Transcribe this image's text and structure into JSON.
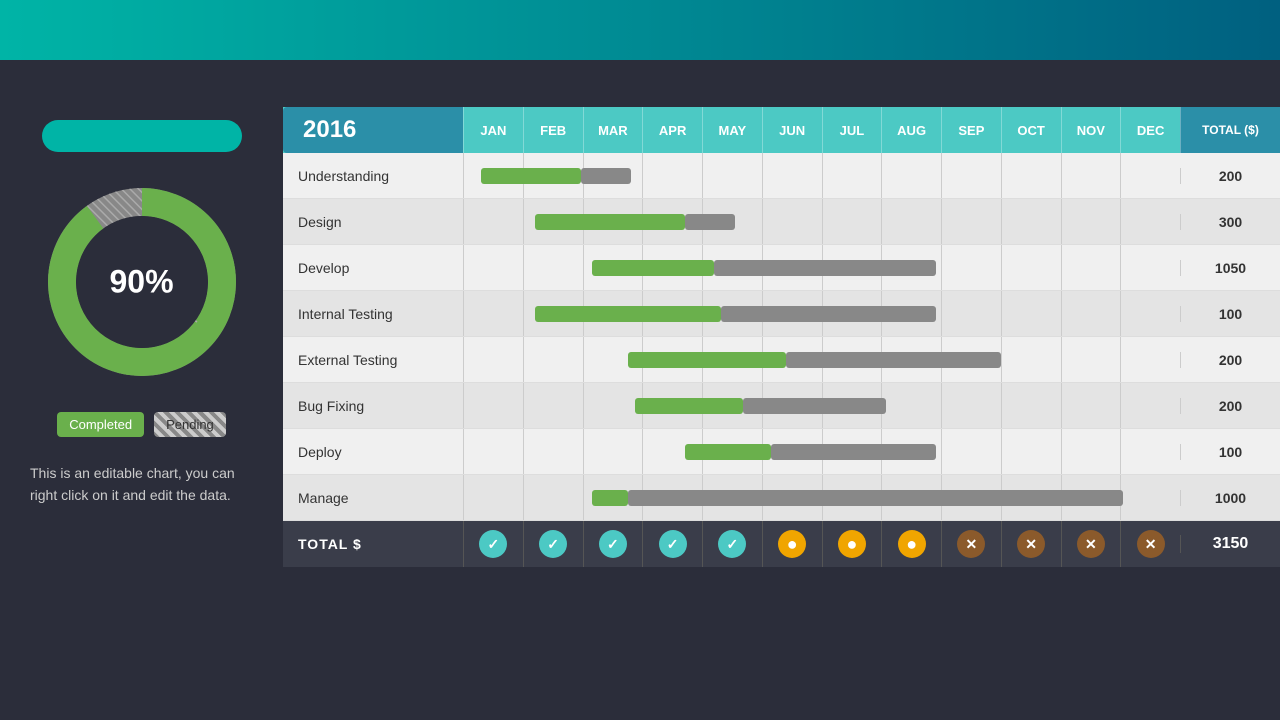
{
  "header": {
    "year": "2016",
    "months": [
      "JAN",
      "FEB",
      "MAR",
      "APR",
      "MAY",
      "JUN",
      "JUL",
      "AUG",
      "SEP",
      "OCT",
      "NOV",
      "DEC"
    ],
    "total_label": "TOTAL ($)"
  },
  "left_panel": {
    "percentage": "90%",
    "legend": {
      "completed": "Completed",
      "pending": "Pending"
    },
    "info_text": "This is an editable chart, you can right click on it and edit the data."
  },
  "rows": [
    {
      "label": "Understanding",
      "total": "200",
      "green_start_pct": 2.5,
      "green_width_pct": 14,
      "gray_start_pct": 16.5,
      "gray_width_pct": 7
    },
    {
      "label": "Design",
      "total": "300",
      "green_start_pct": 10,
      "green_width_pct": 21,
      "gray_start_pct": 31,
      "gray_width_pct": 7
    },
    {
      "label": "Develop",
      "total": "1050",
      "green_start_pct": 18,
      "green_width_pct": 17,
      "gray_start_pct": 35,
      "gray_width_pct": 31
    },
    {
      "label": "Internal Testing",
      "total": "100",
      "green_start_pct": 10,
      "green_width_pct": 26,
      "gray_start_pct": 36,
      "gray_width_pct": 30
    },
    {
      "label": "External Testing",
      "total": "200",
      "green_start_pct": 23,
      "green_width_pct": 22,
      "gray_start_pct": 45,
      "gray_width_pct": 30
    },
    {
      "label": "Bug Fixing",
      "total": "200",
      "green_start_pct": 24,
      "green_width_pct": 15,
      "gray_start_pct": 39,
      "gray_width_pct": 20
    },
    {
      "label": "Deploy",
      "total": "100",
      "green_start_pct": 31,
      "green_width_pct": 12,
      "gray_start_pct": 43,
      "gray_width_pct": 23
    },
    {
      "label": "Manage",
      "total": "1000",
      "green_start_pct": 18,
      "green_width_pct": 5,
      "gray_start_pct": 23,
      "gray_width_pct": 69
    }
  ],
  "total_row": {
    "label": "TOTAL $",
    "total": "3150",
    "statuses": [
      "check",
      "check",
      "check",
      "check",
      "check",
      "circle",
      "circle",
      "circle",
      "x",
      "x",
      "x",
      "x"
    ]
  },
  "donut": {
    "completed_pct": 90,
    "pending_pct": 10,
    "colors": {
      "completed": "#6ab04c",
      "pending": "#ccc",
      "bg": "#2b2d3a"
    }
  }
}
